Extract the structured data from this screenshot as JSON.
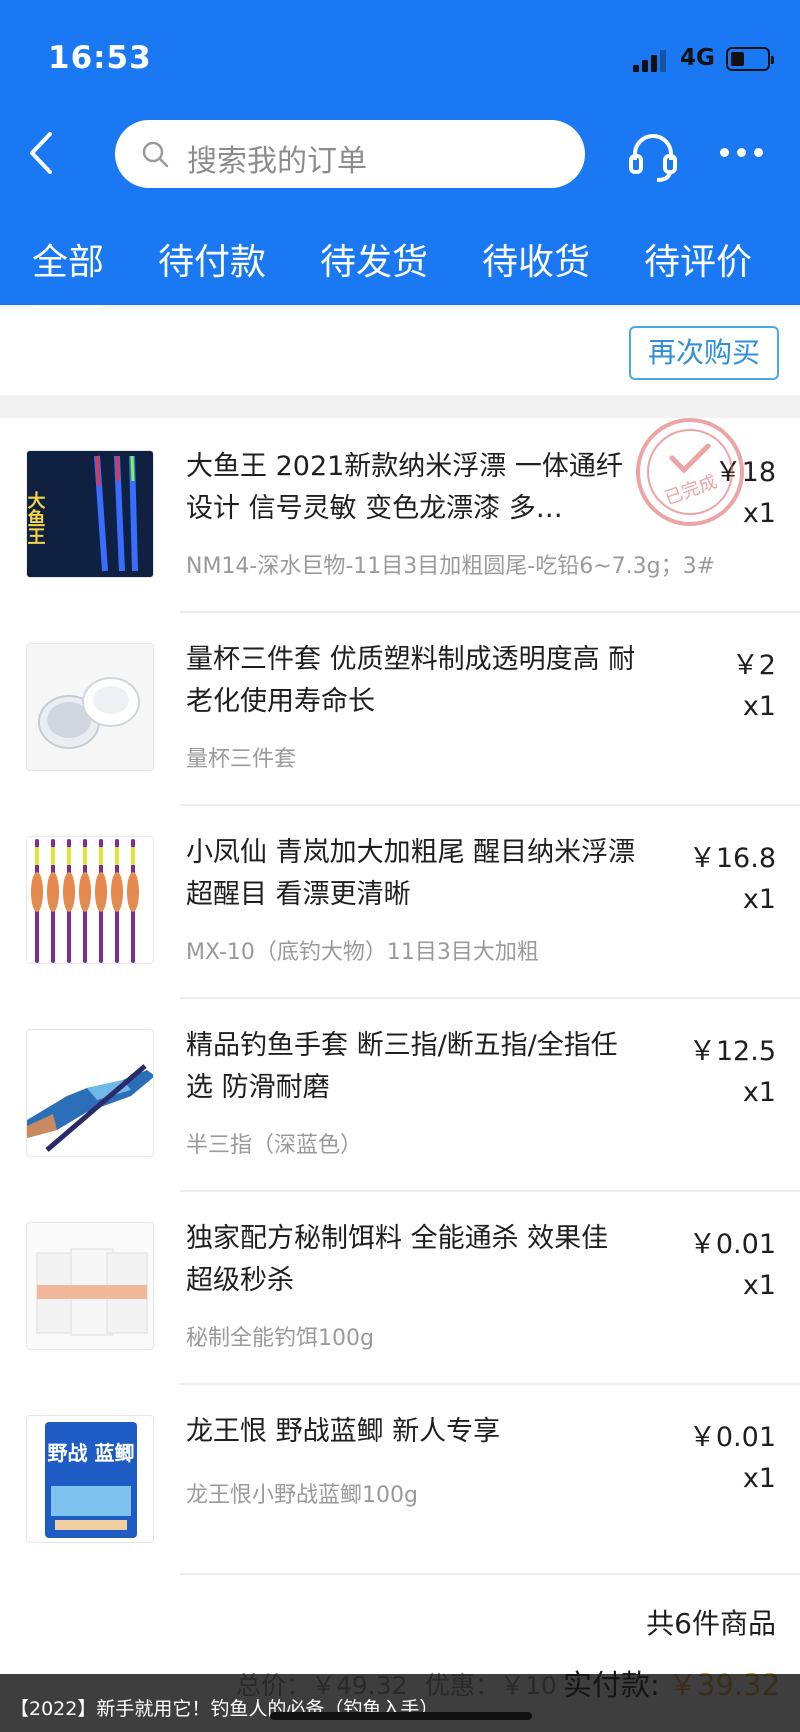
{
  "status_bar": {
    "time": "16:53",
    "network": "4G"
  },
  "header": {
    "search_placeholder": "搜索我的订单",
    "tabs": [
      {
        "label": "全部",
        "active": true
      },
      {
        "label": "待付款",
        "active": false
      },
      {
        "label": "待发货",
        "active": false
      },
      {
        "label": "待收货",
        "active": false
      },
      {
        "label": "待评价",
        "active": false
      }
    ]
  },
  "previous_order": {
    "rebuy_label": "再次购买"
  },
  "order": {
    "status_stamp": "已完成",
    "items": [
      {
        "title": "大鱼王 2021新款纳米浮漂 一体通纤设计 信号灵敏 变色龙漂漆 多…",
        "sku": "NM14-深水巨物-11目3目加粗圆尾-吃铅6~7.3g；3#",
        "price": "￥18",
        "qty": "x1",
        "thumb_text": "大鱼王"
      },
      {
        "title": "量杯三件套 优质塑料制成透明度高 耐老化使用寿命长",
        "sku": "量杯三件套",
        "price": "￥2",
        "qty": "x1"
      },
      {
        "title": "小凤仙 青岚加大加粗尾 醒目纳米浮漂 超醒目 看漂更清晰",
        "sku": "MX-10（底钓大物）11目3目大加粗",
        "price": "￥16.8",
        "qty": "x1"
      },
      {
        "title": "精品钓鱼手套 断三指/断五指/全指任选 防滑耐磨",
        "sku": "半三指（深蓝色）",
        "price": "￥12.5",
        "qty": "x1"
      },
      {
        "title": "独家配方秘制饵料 全能通杀 效果佳 超级秒杀",
        "sku": "秘制全能钓饵100g",
        "price": "￥0.01",
        "qty": "x1"
      },
      {
        "title": "龙王恨 野战蓝鲫  新人专享",
        "sku": "龙王恨小野战蓝鲫100g",
        "price": "￥0.01",
        "qty": "x1",
        "thumb_text": "野战 蓝鲫"
      }
    ],
    "total_count": "共6件商品",
    "original_price": "总价：￥49.32",
    "discount": "优惠：￥10",
    "paid_label": "实付款:",
    "paid_amount": "￥39.32"
  },
  "banner": {
    "text": "【2022】新手就用它！钓鱼人的必备（钓鱼入手）"
  },
  "colors": {
    "header_blue": "#1a78f2",
    "accent_orange": "#e7a23a",
    "rebuy_blue": "#2f8fd8"
  }
}
